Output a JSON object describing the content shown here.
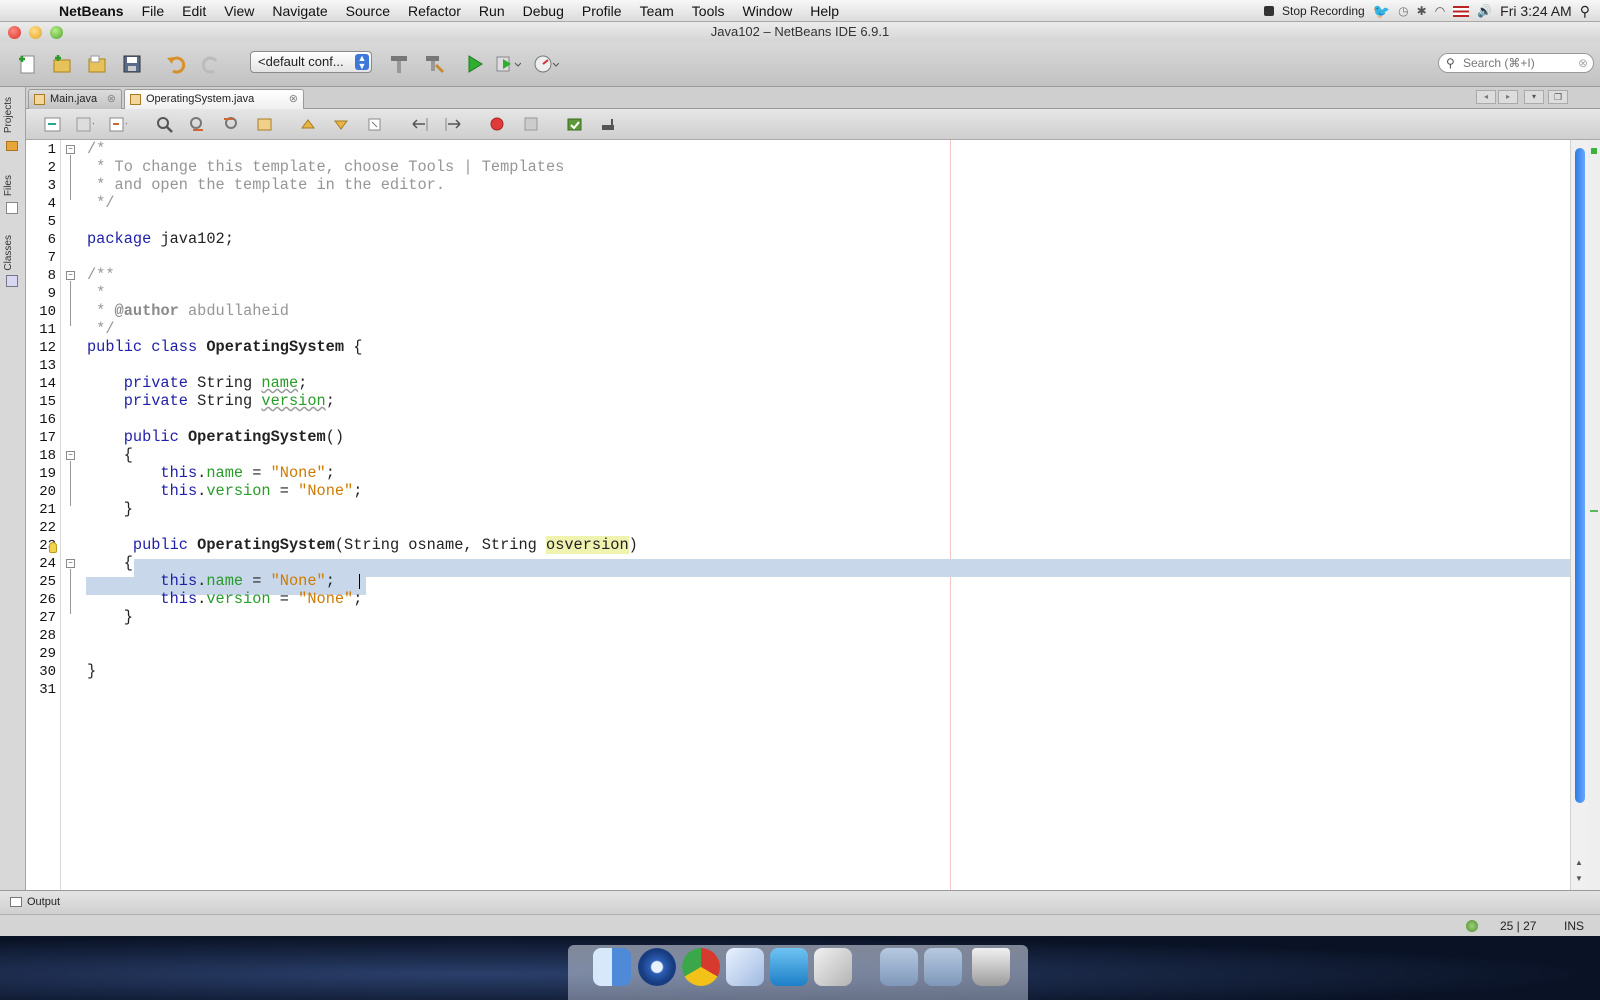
{
  "menubar": {
    "app": "NetBeans",
    "items": [
      "File",
      "Edit",
      "View",
      "Navigate",
      "Source",
      "Refactor",
      "Run",
      "Debug",
      "Profile",
      "Team",
      "Tools",
      "Window",
      "Help"
    ],
    "stop_recording": "Stop Recording",
    "clock": "Fri 3:24 AM"
  },
  "window": {
    "title": "Java102 – NetBeans IDE 6.9.1"
  },
  "toolbar": {
    "config_value": "<default conf...",
    "search_placeholder": "Search (⌘+I)",
    "icons": [
      "new-file-icon",
      "new-project-icon",
      "open-project-icon",
      "save-all-icon",
      "undo-icon",
      "redo-icon",
      "build-icon",
      "clean-build-icon",
      "run-icon",
      "debug-icon",
      "profile-icon"
    ]
  },
  "left_panels": [
    "Projects",
    "Files",
    "Classes"
  ],
  "tabs": [
    {
      "label": "Main.java",
      "active": false
    },
    {
      "label": "OperatingSystem.java",
      "active": true
    }
  ],
  "editor": {
    "line_numbers": [
      "1",
      "2",
      "3",
      "4",
      "5",
      "6",
      "7",
      "8",
      "9",
      "10",
      "11",
      "12",
      "13",
      "14",
      "15",
      "16",
      "17",
      "18",
      "19",
      "20",
      "21",
      "22",
      "23",
      "24",
      "25",
      "26",
      "27",
      "28",
      "29",
      "30",
      "31"
    ],
    "lines": {
      "l1": "/*",
      "l2": " * To change this template, choose Tools | Templates",
      "l3": " * and open the template in the editor.",
      "l4": " */",
      "l6_kw": "package",
      "l6_rest": " java102;",
      "l8": "/**",
      "l9": " *",
      "l10_pre": " * ",
      "l10_tag": "@author",
      "l10_rest": " abdullaheid",
      "l11": " */",
      "l12_kw": "public class",
      "l12_name": "OperatingSystem",
      "l12_rest": " {",
      "l14_kw": "    private",
      "l14_type": " String ",
      "l14_field": "name",
      "l14_end": ";",
      "l15_kw": "    private",
      "l15_type": " String ",
      "l15_field": "version",
      "l15_end": ";",
      "l17_kw": "    public",
      "l17_name": "OperatingSystem",
      "l17_rest": "()",
      "l18": "    {",
      "l19_kw": "        this",
      "l19_dot": ".",
      "l19_field": "name",
      "l19_eq": " = ",
      "l19_str": "\"None\"",
      "l19_end": ";",
      "l20_kw": "        this",
      "l20_dot": ".",
      "l20_field": "version",
      "l20_eq": " = ",
      "l20_str": "\"None\"",
      "l20_end": ";",
      "l21": "    }",
      "l23_kw": "     public",
      "l23_name": "OperatingSystem",
      "l23_rest": "(String osname, String ",
      "l23_param": "osversion",
      "l23_close": ")",
      "l24": "    {",
      "l25_kw": "        this",
      "l25_dot": ".",
      "l25_field": "name",
      "l25_eq": " = ",
      "l25_str": "\"None\"",
      "l25_end": ";",
      "l26_kw": "        this",
      "l26_dot": ".",
      "l26_field": "version",
      "l26_eq": " = ",
      "l26_str": "\"None\"",
      "l26_end": ";",
      "l27": "    }",
      "l30": "}"
    }
  },
  "output_tab": "Output",
  "status": {
    "position": "25 | 27",
    "mode": "INS"
  },
  "dock": [
    "finder-icon",
    "quicktime-icon",
    "chrome-icon",
    "virtualbox-icon",
    "twitter-icon",
    "preview-icon",
    "applications-folder-icon",
    "documents-folder-icon",
    "trash-icon"
  ]
}
